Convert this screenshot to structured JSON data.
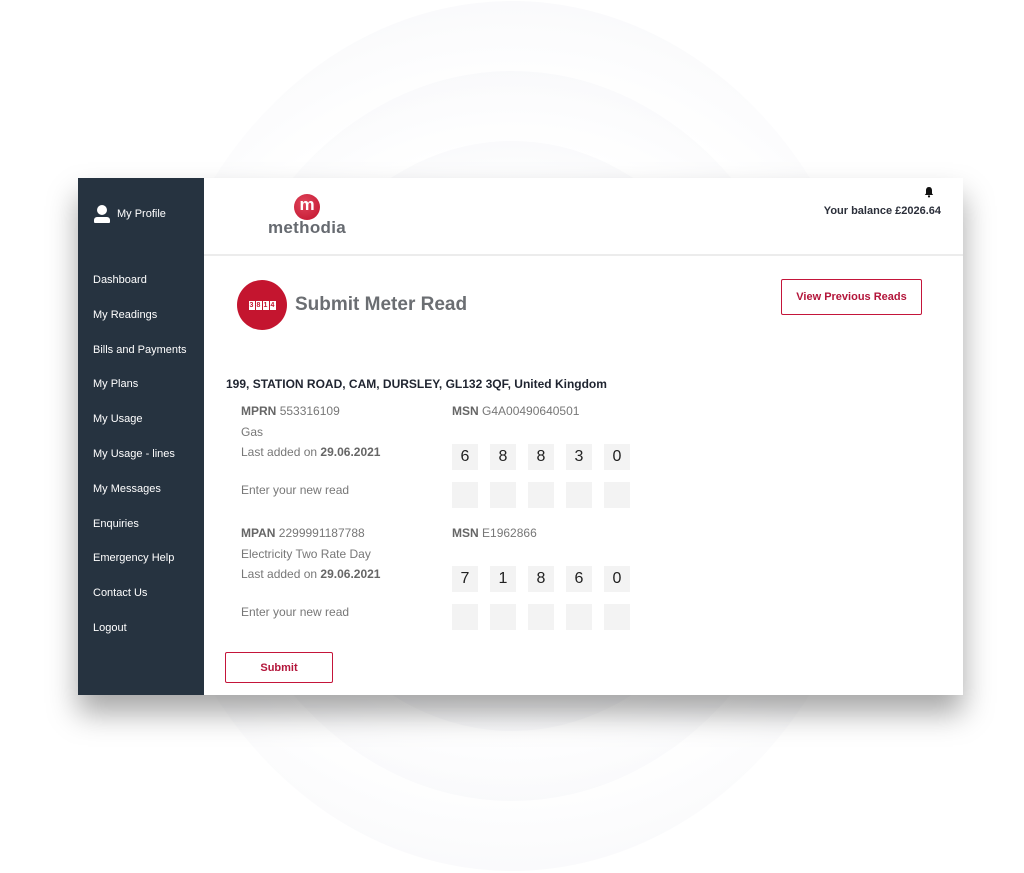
{
  "sidebar": {
    "profile_label": "My Profile",
    "items": [
      {
        "label": "Dashboard"
      },
      {
        "label": "My Readings"
      },
      {
        "label": "Bills and Payments"
      },
      {
        "label": "My Plans"
      },
      {
        "label": "My Usage"
      },
      {
        "label": "My Usage - lines"
      },
      {
        "label": "My Messages"
      },
      {
        "label": "Enquiries"
      },
      {
        "label": "Emergency Help"
      },
      {
        "label": "Contact Us"
      },
      {
        "label": "Logout"
      }
    ]
  },
  "header": {
    "logo_letter": "m",
    "logo_text": "methodia",
    "balance": "Your balance £2026.64"
  },
  "page": {
    "title": "Submit Meter Read",
    "icon_counter": [
      "3",
      "8",
      "1",
      "4"
    ],
    "view_previous_label": "View Previous Reads",
    "address": "199, STATION ROAD, CAM, DURSLEY, GL132 3QF, United Kingdom",
    "submit_label": "Submit"
  },
  "meters": [
    {
      "id_label": "MPRN",
      "id_value": "553316109",
      "msn_label": "MSN",
      "msn_value": "G4A00490640501",
      "fuel": "Gas",
      "last_added_prefix": "Last added on",
      "last_added_date": "29.06.2021",
      "last_read": [
        "6",
        "8",
        "8",
        "3",
        "0"
      ],
      "new_read_label": "Enter your new read",
      "new_read": [
        "",
        "",
        "",
        "",
        ""
      ]
    },
    {
      "id_label": "MPAN",
      "id_value": "2299991187788",
      "msn_label": "MSN",
      "msn_value": "E1962866",
      "fuel": "Electricity Two Rate Day",
      "last_added_prefix": "Last added on",
      "last_added_date": "29.06.2021",
      "last_read": [
        "7",
        "1",
        "8",
        "6",
        "0"
      ],
      "new_read_label": "Enter your new read",
      "new_read": [
        "",
        "",
        "",
        "",
        ""
      ]
    }
  ]
}
